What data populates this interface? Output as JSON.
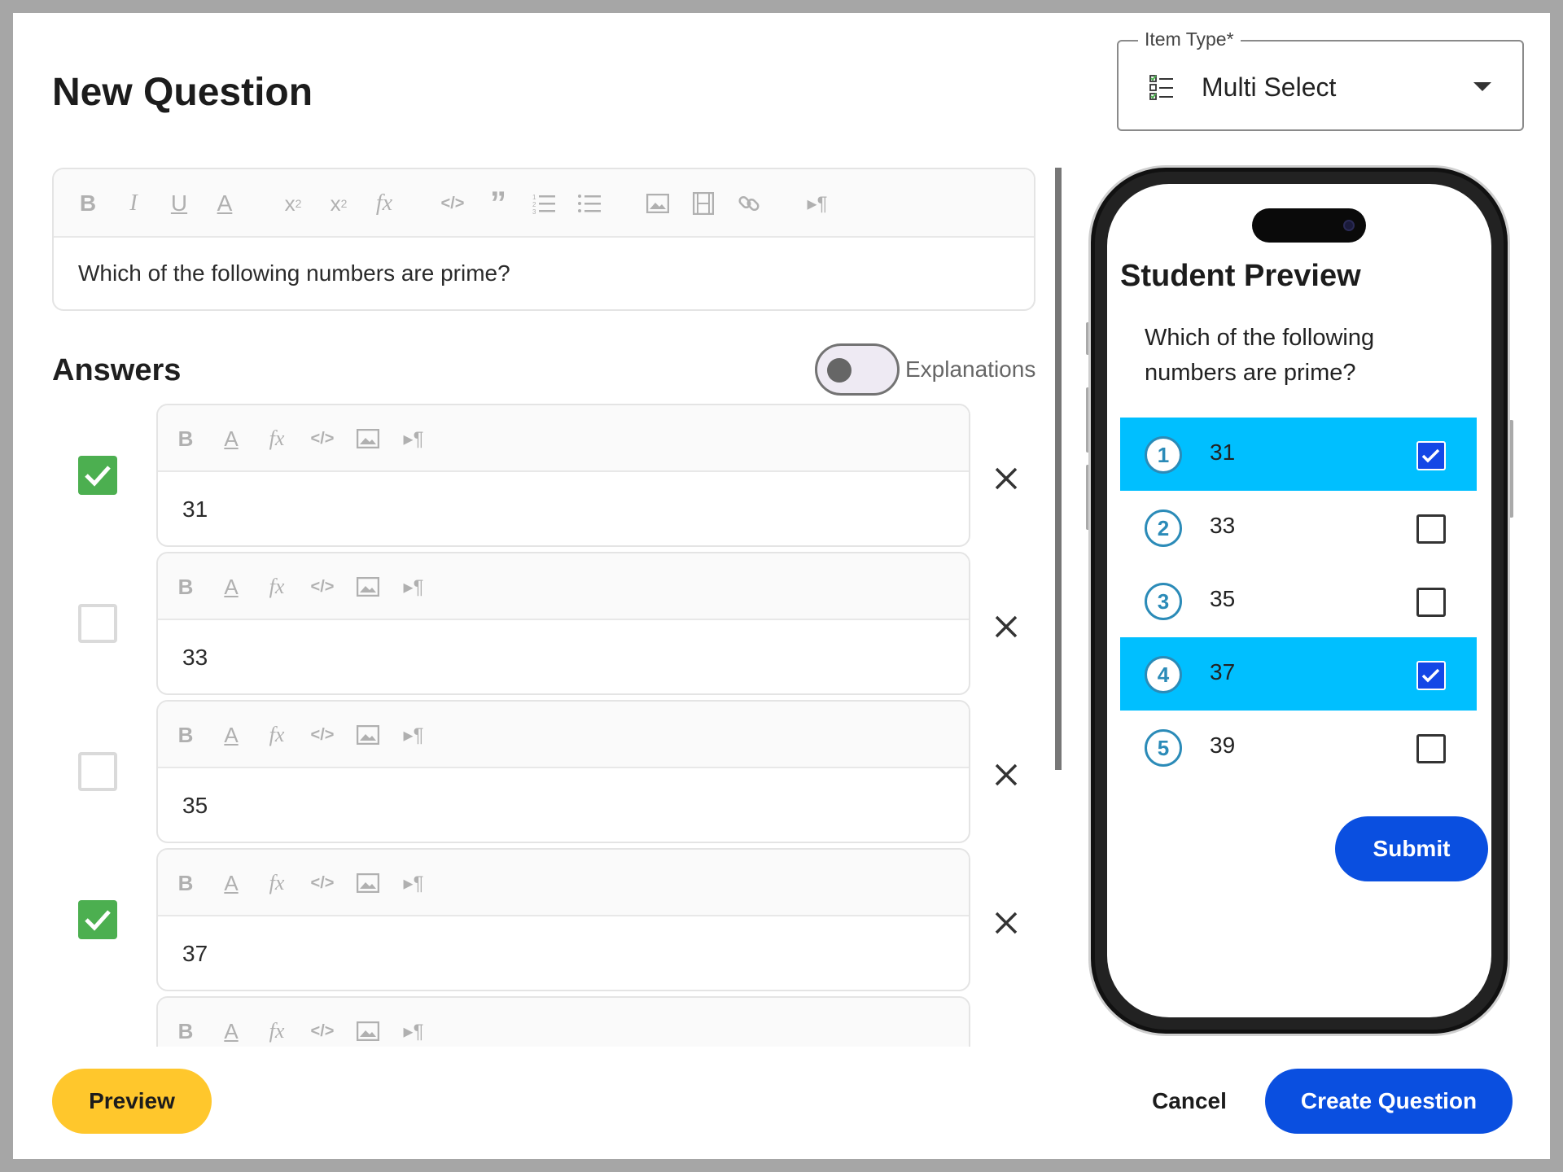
{
  "dialog": {
    "title": "New Question"
  },
  "item_type": {
    "legend": "Item Type*",
    "value": "Multi Select",
    "icon": "multi-select-list-icon"
  },
  "question_editor": {
    "toolbar": [
      "bold",
      "italic",
      "underline",
      "text-color",
      "subscript",
      "superscript",
      "formula",
      "code",
      "quote",
      "ordered-list",
      "bullet-list",
      "image",
      "video",
      "link",
      "paragraph-direction"
    ],
    "content": "Which of the following numbers are prime?"
  },
  "answers": {
    "title": "Answers",
    "explanations_label": "Explanations",
    "explanations_on": false,
    "items": [
      {
        "text": "31",
        "correct": true
      },
      {
        "text": "33",
        "correct": false
      },
      {
        "text": "35",
        "correct": false
      },
      {
        "text": "37",
        "correct": true
      },
      {
        "text": "",
        "correct": false
      }
    ]
  },
  "colors": {
    "correct": "#4caf50",
    "primary": "#0a4fe0",
    "selected_option": "#00bfff",
    "preview_button": "#ffc72c"
  },
  "student_preview": {
    "title": "Student Preview",
    "question": "Which of the following numbers are prime?",
    "options": [
      {
        "number": "1",
        "label": "31",
        "selected": true
      },
      {
        "number": "2",
        "label": "33",
        "selected": false
      },
      {
        "number": "3",
        "label": "35",
        "selected": false
      },
      {
        "number": "4",
        "label": "37",
        "selected": true
      },
      {
        "number": "5",
        "label": "39",
        "selected": false
      }
    ],
    "submit_label": "Submit"
  },
  "footer": {
    "preview_label": "Preview",
    "cancel_label": "Cancel",
    "create_label": "Create Question"
  }
}
